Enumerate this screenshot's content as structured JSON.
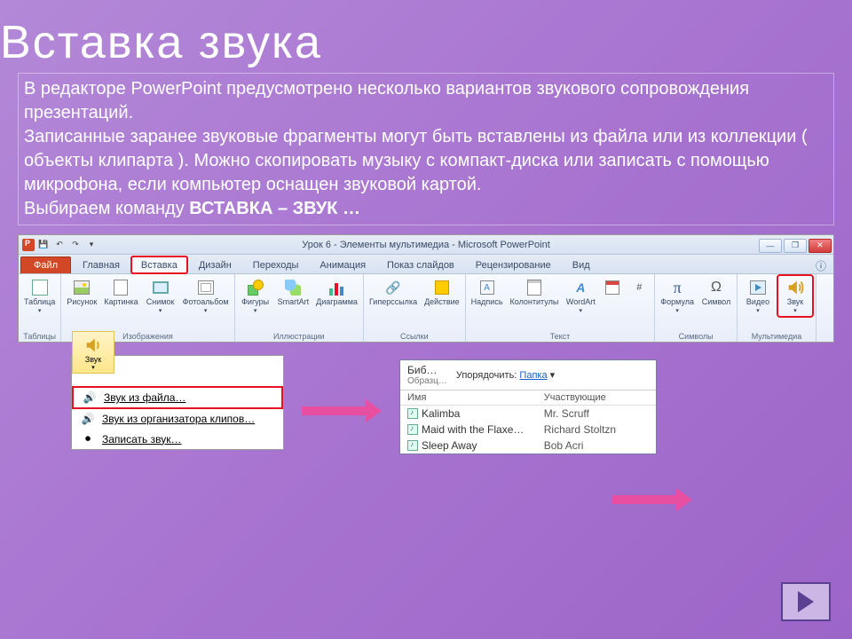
{
  "slide": {
    "title": "Вставка звука",
    "para1": "В редакторе PowerPoint предусмотрено несколько вариантов звукового сопровождения презентаций.",
    "para2": "Записанные заранее звуковые фрагменты могут быть вставлены из файла или из коллекции ( объекты клипарта ). Можно скопировать музыку с компакт-диска или записать с помощью микрофона, если компьютер оснащен звуковой картой.",
    "para3_lead": "Выбираем команду ",
    "para3_bold": "ВСТАВКА – ЗВУК …"
  },
  "ribbon": {
    "window_title": "Урок 6 - Элементы мультимедиа - Microsoft PowerPoint",
    "file_tab": "Файл",
    "tabs": [
      "Главная",
      "Вставка",
      "Дизайн",
      "Переходы",
      "Анимация",
      "Показ слайдов",
      "Рецензирование",
      "Вид"
    ],
    "active_tab_index": 1,
    "groups": {
      "tables": {
        "label": "Таблицы",
        "items": [
          "Таблица"
        ]
      },
      "images": {
        "label": "Изображения",
        "items": [
          "Рисунок",
          "Картинка",
          "Снимок",
          "Фотоальбом"
        ]
      },
      "illus": {
        "label": "Иллюстрации",
        "items": [
          "Фигуры",
          "SmartArt",
          "Диаграмма"
        ]
      },
      "links": {
        "label": "Ссылки",
        "items": [
          "Гиперссылка",
          "Действие"
        ]
      },
      "text": {
        "label": "Текст",
        "items": [
          "Надпись",
          "Колонтитулы",
          "WordArt",
          "",
          ""
        ]
      },
      "symbols": {
        "label": "Символы",
        "items": [
          "Формула",
          "Символ"
        ]
      },
      "media": {
        "label": "Мультимедиа",
        "items": [
          "Видео",
          "Звук"
        ]
      }
    }
  },
  "sound_menu": {
    "header": "Звук",
    "items": [
      "Звук из файла…",
      "Звук из организатора клипов…",
      "Записать звук…"
    ]
  },
  "file_panel": {
    "location": "Биб…",
    "location_sub": "Образц…",
    "sort_label": "Упорядочить:",
    "sort_value": "Папка",
    "col_name": "Имя",
    "col_artist": "Участвующие",
    "rows": [
      {
        "name": "Kalimba",
        "artist": "Mr. Scruff"
      },
      {
        "name": "Maid with the Flaxe…",
        "artist": "Richard Stoltzn"
      },
      {
        "name": "Sleep Away",
        "artist": "Bob Acri"
      }
    ]
  }
}
